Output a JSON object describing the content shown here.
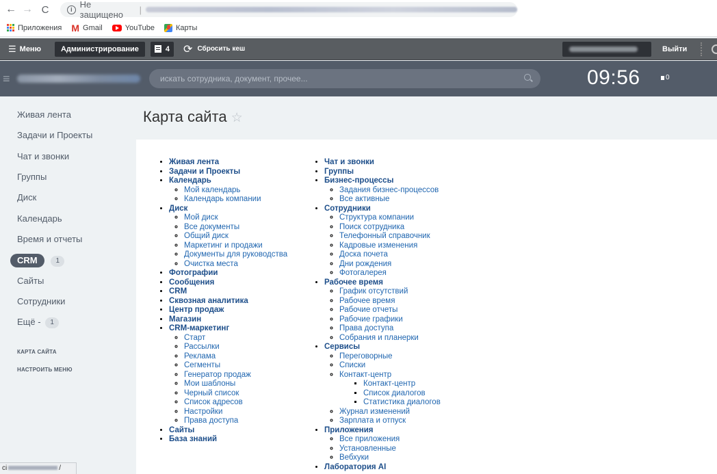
{
  "browser": {
    "not_secure": "Не защищено",
    "bookmarks": [
      "Приложения",
      "Gmail",
      "YouTube",
      "Карты"
    ]
  },
  "admin": {
    "menu_label": "Меню",
    "admin_label": "Администрирование",
    "badge_count": "4",
    "cache_label": "Сбросить кеш",
    "logout_label": "Выйти"
  },
  "header": {
    "search_placeholder": "искать сотрудника, документ, прочее...",
    "time": "09:56",
    "flag_count": "0"
  },
  "sidebar": {
    "items": [
      "Живая лента",
      "Задачи и Проекты",
      "Чат и звонки",
      "Группы",
      "Диск",
      "Календарь",
      "Время и отчеты",
      "CRM",
      "Сайты",
      "Сотрудники",
      "Ещё -"
    ],
    "crm_counter": "1",
    "more_counter": "1",
    "sitemap_label": "КАРТА САЙТА",
    "configure_label": "НАСТРОИТЬ МЕНЮ",
    "status_prefix": "ci",
    "status_suffix": "/"
  },
  "page": {
    "title": "Карта сайта"
  },
  "sitemap": {
    "col1": [
      {
        "label": "Живая лента",
        "children": []
      },
      {
        "label": "Задачи и Проекты",
        "children": []
      },
      {
        "label": "Календарь",
        "children": [
          "Мой календарь",
          "Календарь компании"
        ]
      },
      {
        "label": "Диск",
        "children": [
          "Мой диск",
          "Все документы",
          "Общий диск",
          "Маркетинг и продажи",
          "Документы для руководства",
          "Очистка места"
        ]
      },
      {
        "label": "Фотографии",
        "children": []
      },
      {
        "label": "Сообщения",
        "children": []
      },
      {
        "label": "CRM",
        "children": []
      },
      {
        "label": "Сквозная аналитика",
        "children": []
      },
      {
        "label": "Центр продаж",
        "children": []
      },
      {
        "label": "Магазин",
        "children": []
      },
      {
        "label": "CRM-маркетинг",
        "children": [
          "Старт",
          "Рассылки",
          "Реклама",
          "Сегменты",
          "Генератор продаж",
          "Мои шаблоны",
          "Черный список",
          "Список адресов",
          "Настройки",
          "Права доступа"
        ]
      },
      {
        "label": "Сайты",
        "children": []
      },
      {
        "label": "База знаний",
        "children": []
      }
    ],
    "col2_a": [
      {
        "label": "Чат и звонки",
        "children": []
      },
      {
        "label": "Группы",
        "children": []
      },
      {
        "label": "Бизнес-процессы",
        "children": [
          "Задания бизнес-процессов",
          "Все активные"
        ]
      },
      {
        "label": "Сотрудники",
        "children": [
          "Структура компании",
          "Поиск сотрудника",
          "Телефонный справочник",
          "Кадровые изменения",
          "Доска почета",
          "Дни рождения",
          "Фотогалерея"
        ]
      },
      {
        "label": "Рабочее время",
        "children": [
          "График отсутствий",
          "Рабочее время",
          "Рабочие отчеты",
          "Рабочие графики",
          "Права доступа",
          "Собрания и планерки"
        ]
      }
    ],
    "services": {
      "label": "Сервисы",
      "items_before": [
        "Переговорные",
        "Списки"
      ],
      "contact_center": "Контакт-центр",
      "contact_children": [
        "Контакт-центр",
        "Список диалогов",
        "Статистика диалогов"
      ],
      "items_after": [
        "Журнал изменений",
        "Зарплата и отпуск"
      ]
    },
    "col2_b": [
      {
        "label": "Приложения",
        "children": [
          "Все приложения",
          "Установленные",
          "Вебхуки"
        ]
      },
      {
        "label": "Лаборатория AI",
        "children": []
      }
    ]
  }
}
